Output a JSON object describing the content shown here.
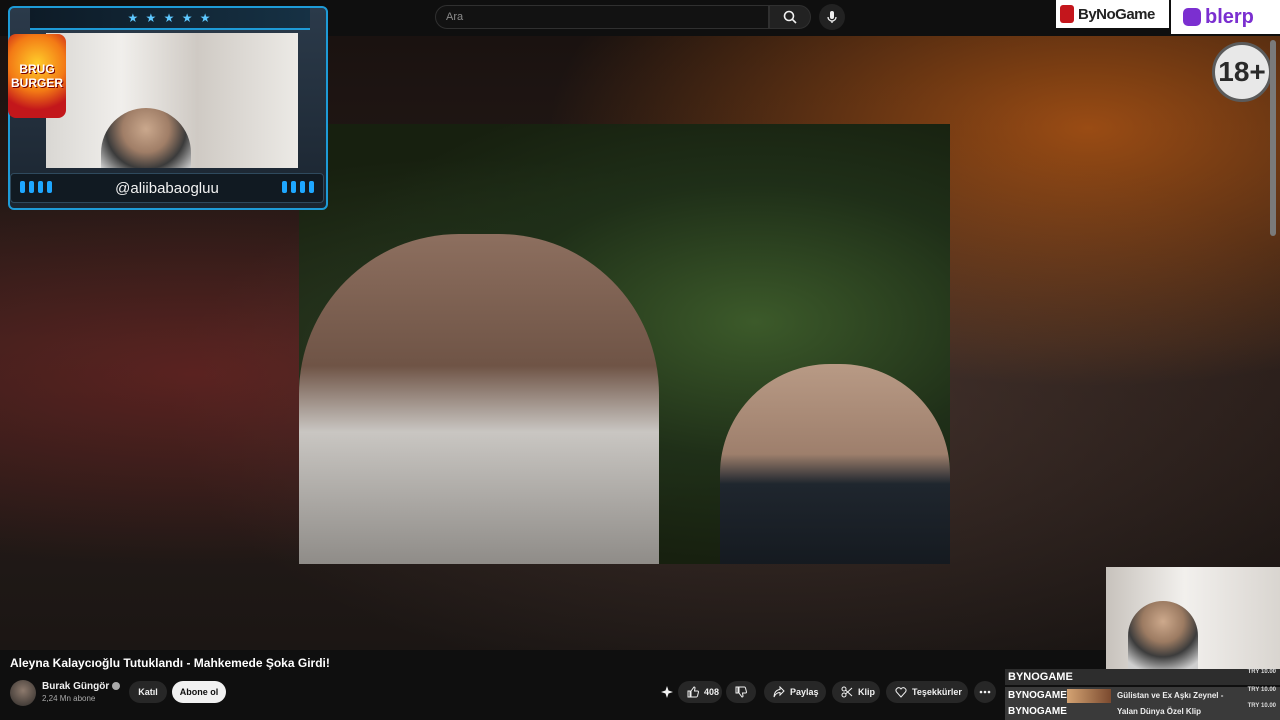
{
  "search": {
    "placeholder": "Ara"
  },
  "logos": {
    "bynogame": "ByNoGame",
    "blerp": "blerp"
  },
  "badge": {
    "age": "18+"
  },
  "webcam": {
    "handle": "@aliibabaogluu",
    "sponsor_line1": "BRUG",
    "sponsor_line2": "BURGER"
  },
  "video": {
    "title": "Aleyna Kalaycıoğlu Tutuklandı - Mahkemede Şoka Girdi!",
    "channel": "Burak Güngör",
    "subscribers": "2,24 Mn abone",
    "join_label": "Katıl",
    "subscribe_label": "Abone ol",
    "like_count": "408",
    "share_label": "Paylaş",
    "clip_label": "Klip",
    "thanks_label": "Teşekkürler"
  },
  "donations": [
    {
      "name": "BYNOGAME",
      "amount": "TRY 10.00",
      "message": ""
    },
    {
      "name": "BYNOGAME",
      "amount": "TRY 10.00",
      "message": "Gülistan ve Ex Aşkı Zeynel -"
    },
    {
      "name": "BYNOGAME",
      "amount": "TRY 10.00",
      "message": "Yalan Dünya Özel Klip"
    }
  ],
  "colors": {
    "accent": "#1e9bd7",
    "blerp": "#7b2fd0",
    "bynogame": "#c4161c"
  }
}
